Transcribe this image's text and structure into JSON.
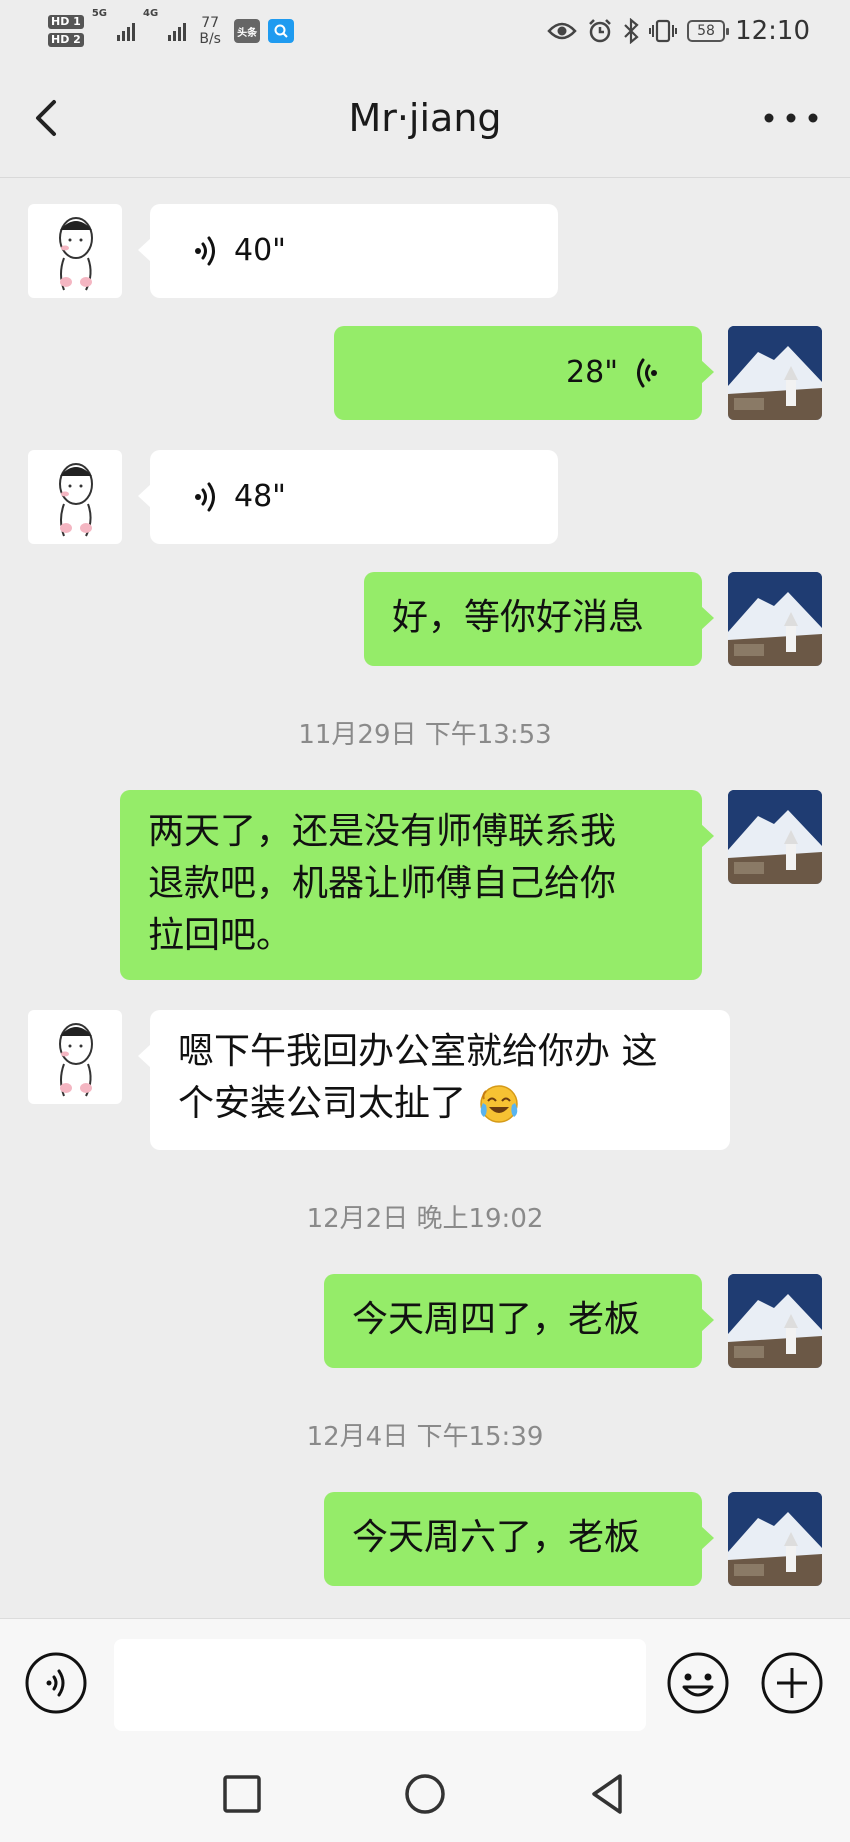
{
  "status_bar": {
    "hd1": "HD 1",
    "hd2": "HD 2",
    "network1": "5G",
    "network2": "4G",
    "speed_value": "77",
    "speed_unit": "B/s",
    "app_badge": "头条",
    "battery": "58",
    "time": "12:10"
  },
  "header": {
    "title": "Mr·jiang"
  },
  "messages": [
    {
      "type": "voice",
      "direction": "in",
      "duration": "40\""
    },
    {
      "type": "voice",
      "direction": "out",
      "duration": "28\""
    },
    {
      "type": "voice",
      "direction": "in",
      "duration": "48\""
    },
    {
      "type": "text",
      "direction": "out",
      "lines": [
        "好，等你好消息"
      ]
    },
    {
      "type": "timestamp",
      "text": "11月29日 下午13:53"
    },
    {
      "type": "text",
      "direction": "out",
      "lines": [
        "两天了，还是没有师傅联系我",
        "退款吧，机器让师傅自己给你",
        "拉回吧。"
      ]
    },
    {
      "type": "text",
      "direction": "in",
      "lines": [
        "嗯下午我回办公室就给你办 这",
        "个安装公司太扯了"
      ],
      "emoji": "crying-laughing-emoji"
    },
    {
      "type": "timestamp",
      "text": "12月2日 晚上19:02"
    },
    {
      "type": "text",
      "direction": "out",
      "lines": [
        "今天周四了，老板"
      ]
    },
    {
      "type": "timestamp",
      "text": "12月4日 下午15:39"
    },
    {
      "type": "text",
      "direction": "out",
      "lines": [
        "今天周六了，老板"
      ]
    }
  ],
  "input_bar": {
    "placeholder": ""
  },
  "colors": {
    "background": "#ededed",
    "outgoing_bubble": "#95ec69",
    "incoming_bubble": "#ffffff",
    "timestamp_text": "#8a8a8a"
  }
}
